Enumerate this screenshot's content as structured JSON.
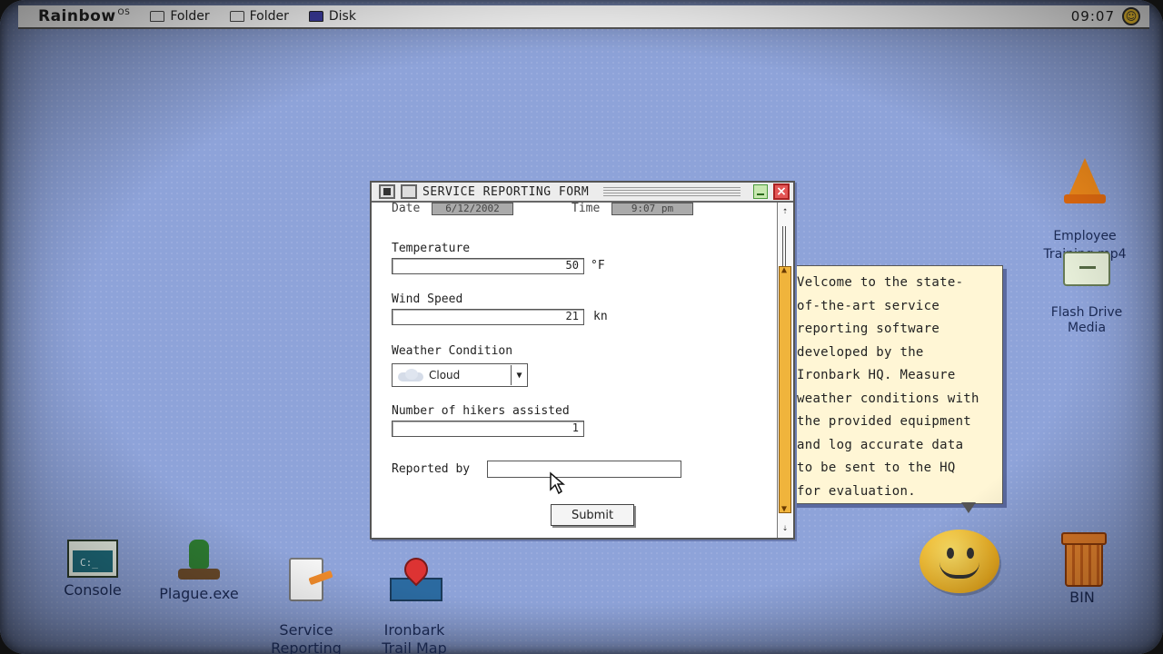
{
  "menubar": {
    "brand": "Rainbow",
    "brand_suffix": "OS",
    "items": [
      {
        "label": "Folder",
        "icon": "folder-icon"
      },
      {
        "label": "Folder",
        "icon": "folder-icon"
      },
      {
        "label": "Disk",
        "icon": "disk-icon"
      }
    ],
    "clock": "09:07"
  },
  "window": {
    "title": "SERVICE REPORTING FORM",
    "date_label": "Date",
    "date_value": "6/12/2002",
    "time_label": "Time",
    "time_value": "9:07 pm",
    "temperature_label": "Temperature",
    "temperature_value": "50",
    "temperature_unit": "°F",
    "wind_label": "Wind Speed",
    "wind_value": "21",
    "wind_unit": "kn",
    "weather_label": "Weather Condition",
    "weather_value": "Cloud",
    "hikers_label": "Number of hikers assisted",
    "hikers_value": "1",
    "reported_label": "Reported by",
    "reported_value": "",
    "submit_label": "Submit"
  },
  "tooltip": {
    "lines": "Velcome to the state-\nof-the-art service\nreporting software\ndeveloped by the\nIronbark HQ. Measure\nweather conditions with\nthe provided equipment\nand log accurate data\nto be sent to the HQ\nfor evaluation."
  },
  "desktop": {
    "console": "Console",
    "plague": "Plague.exe",
    "service": "Service\nReporting",
    "map": "Ironbark\nTrail Map",
    "video": "Employee\nTraining.mp4",
    "flash": "Flash Drive\nMedia",
    "bin": "BIN"
  },
  "colors": {
    "desktop_bg": "#8ea3d9",
    "scroll_thumb": "#f0b43c",
    "tooltip_bg": "#fff6d5",
    "close_red": "#e35555"
  }
}
